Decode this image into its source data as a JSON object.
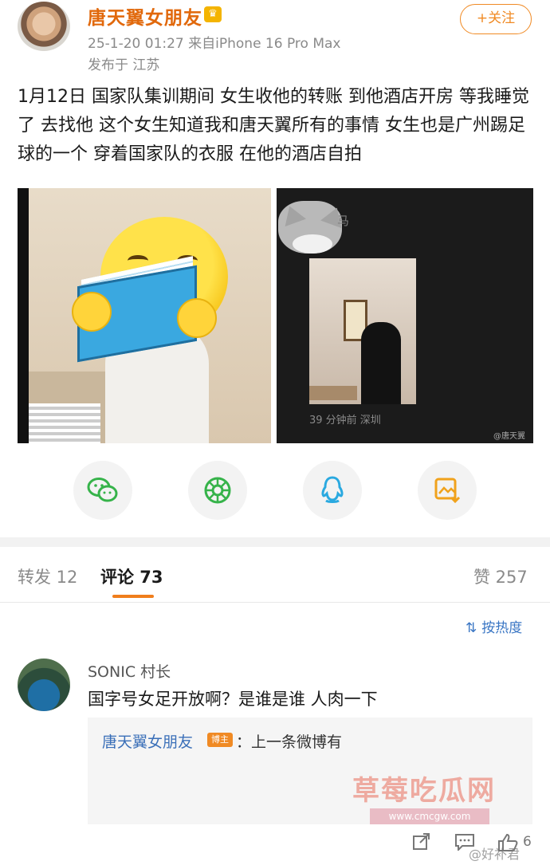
{
  "header": {
    "username": "唐天翼女朋友",
    "crown_badge": "♛",
    "timestamp_device": "25-1-20 01:27  来自iPhone 16 Pro Max",
    "location": "发布于 江苏",
    "follow_label": "+关注"
  },
  "post": {
    "text": "1月12日 国家队集训期间 女生收他的转账 到他酒店开房 等我睡觉了 去找他 这个女生知道我和唐天翼所有的事情 女生也是广州踢足球的一个 穿着国家队的衣服 在他的酒店自拍"
  },
  "images": {
    "right_overlay_char": "马",
    "right_overlay_time": "39 分钟前    深圳",
    "right_watermark": "@唐天翼"
  },
  "share": {
    "icons": [
      "wechat-icon",
      "moments-icon",
      "qq-icon",
      "save-image-icon"
    ]
  },
  "tabs": {
    "repost": "转发 12",
    "comments": "评论 73",
    "likes": "赞 257"
  },
  "sort_label": "按热度",
  "comment": {
    "user": "SONIC 村长",
    "text": "国字号女足开放啊？是谁是谁 人肉一下",
    "reply_user": "唐天翼女朋友",
    "op_badge": "博主",
    "reply_text": "：上一条微博有",
    "like_count": "6"
  },
  "watermarks": {
    "site_name": "草莓吃瓜网",
    "site_url": "www.cmcgw.com",
    "weibo_handle": "@好补君"
  },
  "colors": {
    "accent_orange": "#f08a24",
    "username_orange": "#e1680b",
    "link_blue": "#3a6fb8"
  }
}
